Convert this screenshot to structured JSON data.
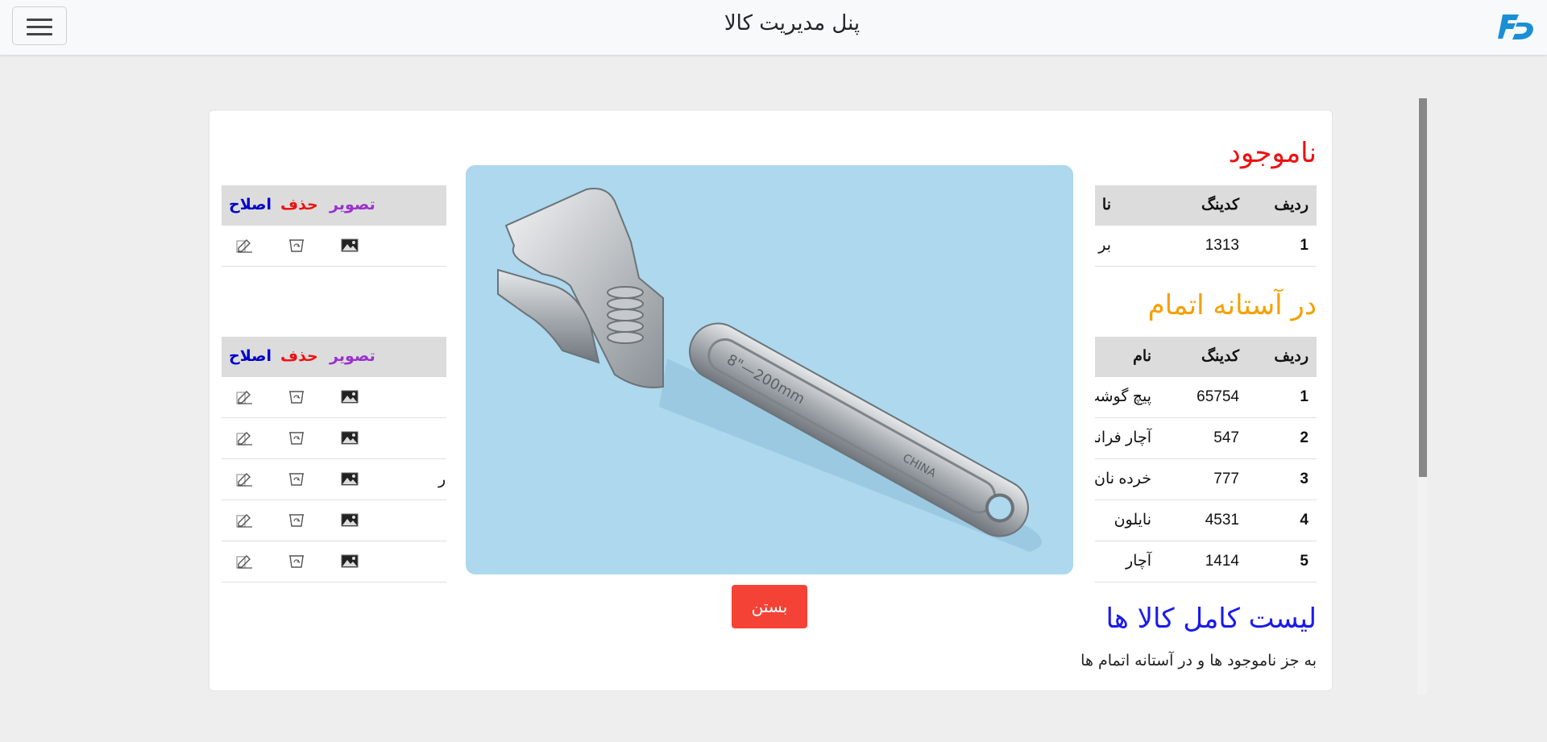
{
  "header": {
    "title": "پنل مدیریت کالا",
    "menu_icon": "hamburger-menu-icon",
    "logo_icon": "fd-logo-icon"
  },
  "sections": {
    "out_of_stock": {
      "title": "ناموجود",
      "color": "#ee1111",
      "columns": [
        "ردیف",
        "کدینگ",
        "نا"
      ],
      "rows": [
        {
          "row": "1",
          "code": "1313",
          "name": "بر"
        }
      ]
    },
    "low_stock": {
      "title": "در آستانه اتمام",
      "color": "#f5a000",
      "columns": [
        "ردیف",
        "کدینگ",
        "نام"
      ],
      "rows": [
        {
          "row": "1",
          "code": "65754",
          "name": "پیچ گوشت"
        },
        {
          "row": "2",
          "code": "547",
          "name": "آچار فرانس"
        },
        {
          "row": "3",
          "code": "777",
          "name": "خرده نان"
        },
        {
          "row": "4",
          "code": "4531",
          "name": "نایلون"
        },
        {
          "row": "5",
          "code": "1414",
          "name": "آچار"
        }
      ]
    },
    "full_list": {
      "title": "لیست کامل کالا ها",
      "color": "#1a1aee",
      "subtitle": "به جز ناموجود ها و در آستانه اتمام ها"
    }
  },
  "action_columns": {
    "image": "تصویر",
    "delete": "حذف",
    "edit": "اصلاح"
  },
  "low_stock_truncated_cell": "ر",
  "modal": {
    "image_alt": "adjustable wrench",
    "close_label": "بستن",
    "close_color": "#f44336"
  },
  "icons": {
    "edit": "edit-icon",
    "delete": "trash-icon",
    "image": "image-icon"
  }
}
